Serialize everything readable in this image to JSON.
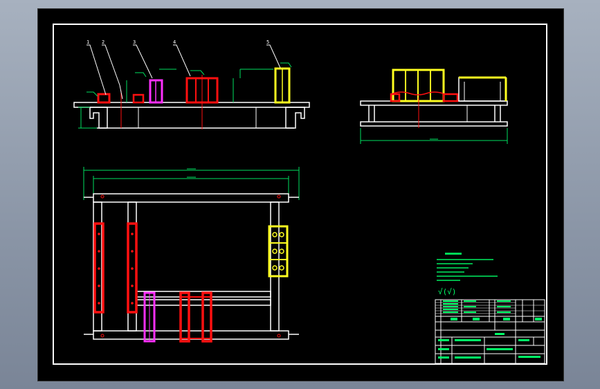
{
  "drawing": {
    "part_numbers": [
      "1",
      "2",
      "3",
      "4",
      "5"
    ],
    "colors": {
      "background": "#000000",
      "outline": "#ffffff",
      "red_part": "#ff1010",
      "magenta_part": "#ff30ff",
      "yellow_part": "#ffff20",
      "dimension": "#00e060",
      "text": "#00ff66"
    },
    "surface_finish_symbol": "√(√)"
  }
}
